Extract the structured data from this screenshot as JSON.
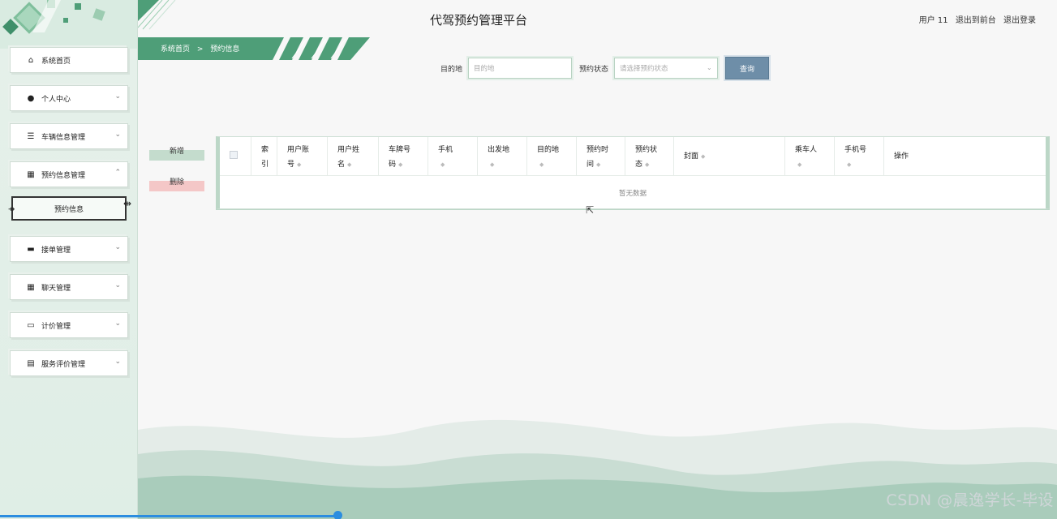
{
  "app": {
    "title": "代驾预约管理平台"
  },
  "header": {
    "user": "用户 11",
    "to_front": "退出到前台",
    "logout": "退出登录"
  },
  "breadcrumb": {
    "home": "系统首页",
    "separator": ">",
    "current": "预约信息"
  },
  "sidebar": {
    "items": [
      {
        "label": "系统首页",
        "icon": "home-icon",
        "glyph": "⌂"
      },
      {
        "label": "个人中心",
        "icon": "user-icon",
        "glyph": "●",
        "chevron": "⌄"
      },
      {
        "label": "车辆信息管理",
        "icon": "list-icon",
        "glyph": "☰",
        "chevron": "⌄"
      },
      {
        "label": "预约信息管理",
        "icon": "grid-icon",
        "glyph": "▦",
        "chevron": "⌃"
      },
      {
        "label": "接单管理",
        "icon": "monitor-icon",
        "glyph": "▬",
        "chevron": "⌄"
      },
      {
        "label": "聊天管理",
        "icon": "grid-icon",
        "glyph": "▦",
        "chevron": "⌄"
      },
      {
        "label": "计价管理",
        "icon": "briefcase-icon",
        "glyph": "▭",
        "chevron": "⌄"
      },
      {
        "label": "服务评价管理",
        "icon": "clipboard-icon",
        "glyph": "▤",
        "chevron": "⌄"
      }
    ],
    "sub_item": "预约信息"
  },
  "search": {
    "destination_label": "目的地",
    "destination_placeholder": "目的地",
    "status_label": "预约状态",
    "status_placeholder": "请选择预约状态",
    "query_button": "查询"
  },
  "actions": {
    "add": "新增",
    "delete": "删除"
  },
  "table": {
    "columns": [
      {
        "line1": "索",
        "line2": "引"
      },
      {
        "line1": "用户账",
        "line2": "号"
      },
      {
        "line1": "用户姓",
        "line2": "名"
      },
      {
        "line1": "车牌号",
        "line2": "码"
      },
      {
        "line1": "手机",
        "line2": ""
      },
      {
        "line1": "出发地",
        "line2": ""
      },
      {
        "line1": "目的地",
        "line2": ""
      },
      {
        "line1": "预约时",
        "line2": "间"
      },
      {
        "line1": "预约状",
        "line2": "态"
      },
      {
        "line1": "封面",
        "line2": ""
      },
      {
        "line1": "乘车人",
        "line2": ""
      },
      {
        "line1": "手机号",
        "line2": ""
      },
      {
        "line1": "操作",
        "line2": ""
      }
    ],
    "empty_text": "暂无数据"
  },
  "watermark": "CSDN @晨逸学长-毕设",
  "colors": {
    "accent_green": "#4e9e78",
    "query_blue": "#6e8ea8",
    "progress_blue": "#2b8de0"
  }
}
